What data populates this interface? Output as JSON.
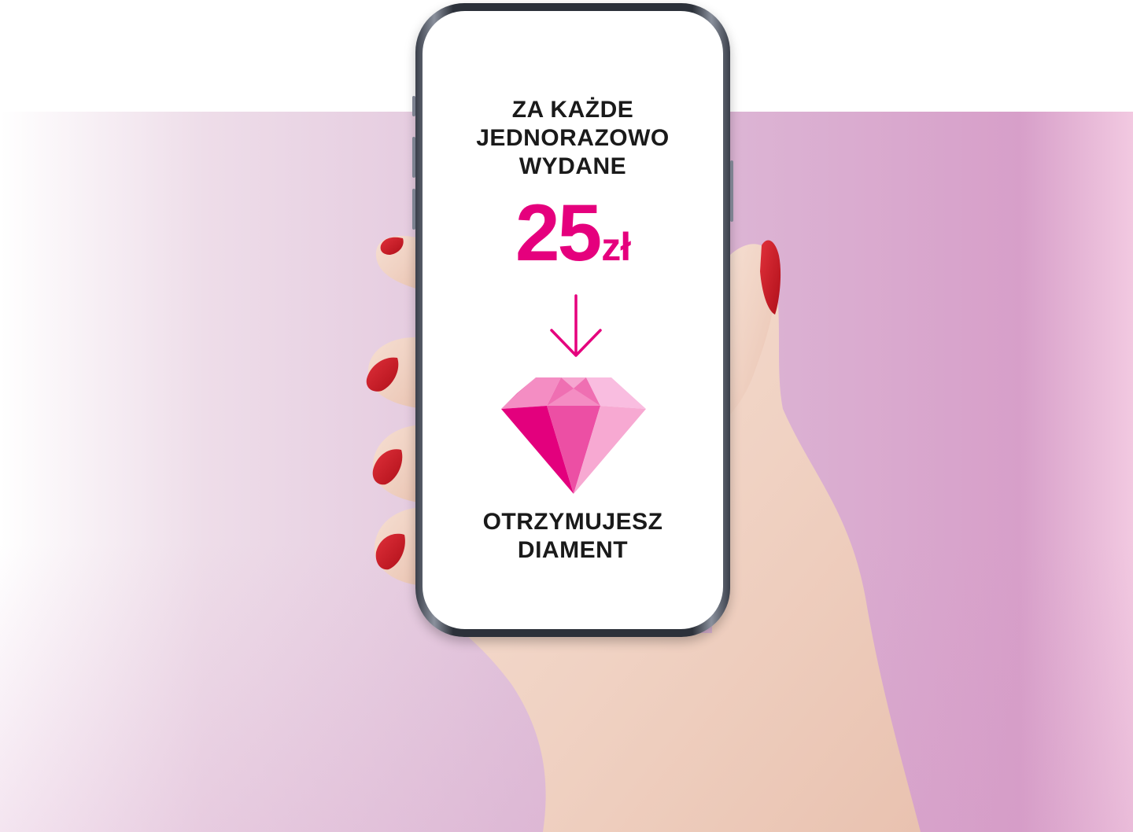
{
  "screen": {
    "headline_lines": [
      "ZA KAŻDE",
      "JEDNORAZOWO",
      "WYDANE"
    ],
    "amount_number": "25",
    "amount_currency": "zł",
    "footer_lines": [
      "OTRZYMUJESZ",
      "DIAMENT"
    ]
  },
  "icons": {
    "arrow": "arrow-down-icon",
    "diamond": "diamond-icon"
  },
  "colors": {
    "accent": "#e5007d",
    "text": "#1a1a1a",
    "nail": "#c8141e"
  }
}
